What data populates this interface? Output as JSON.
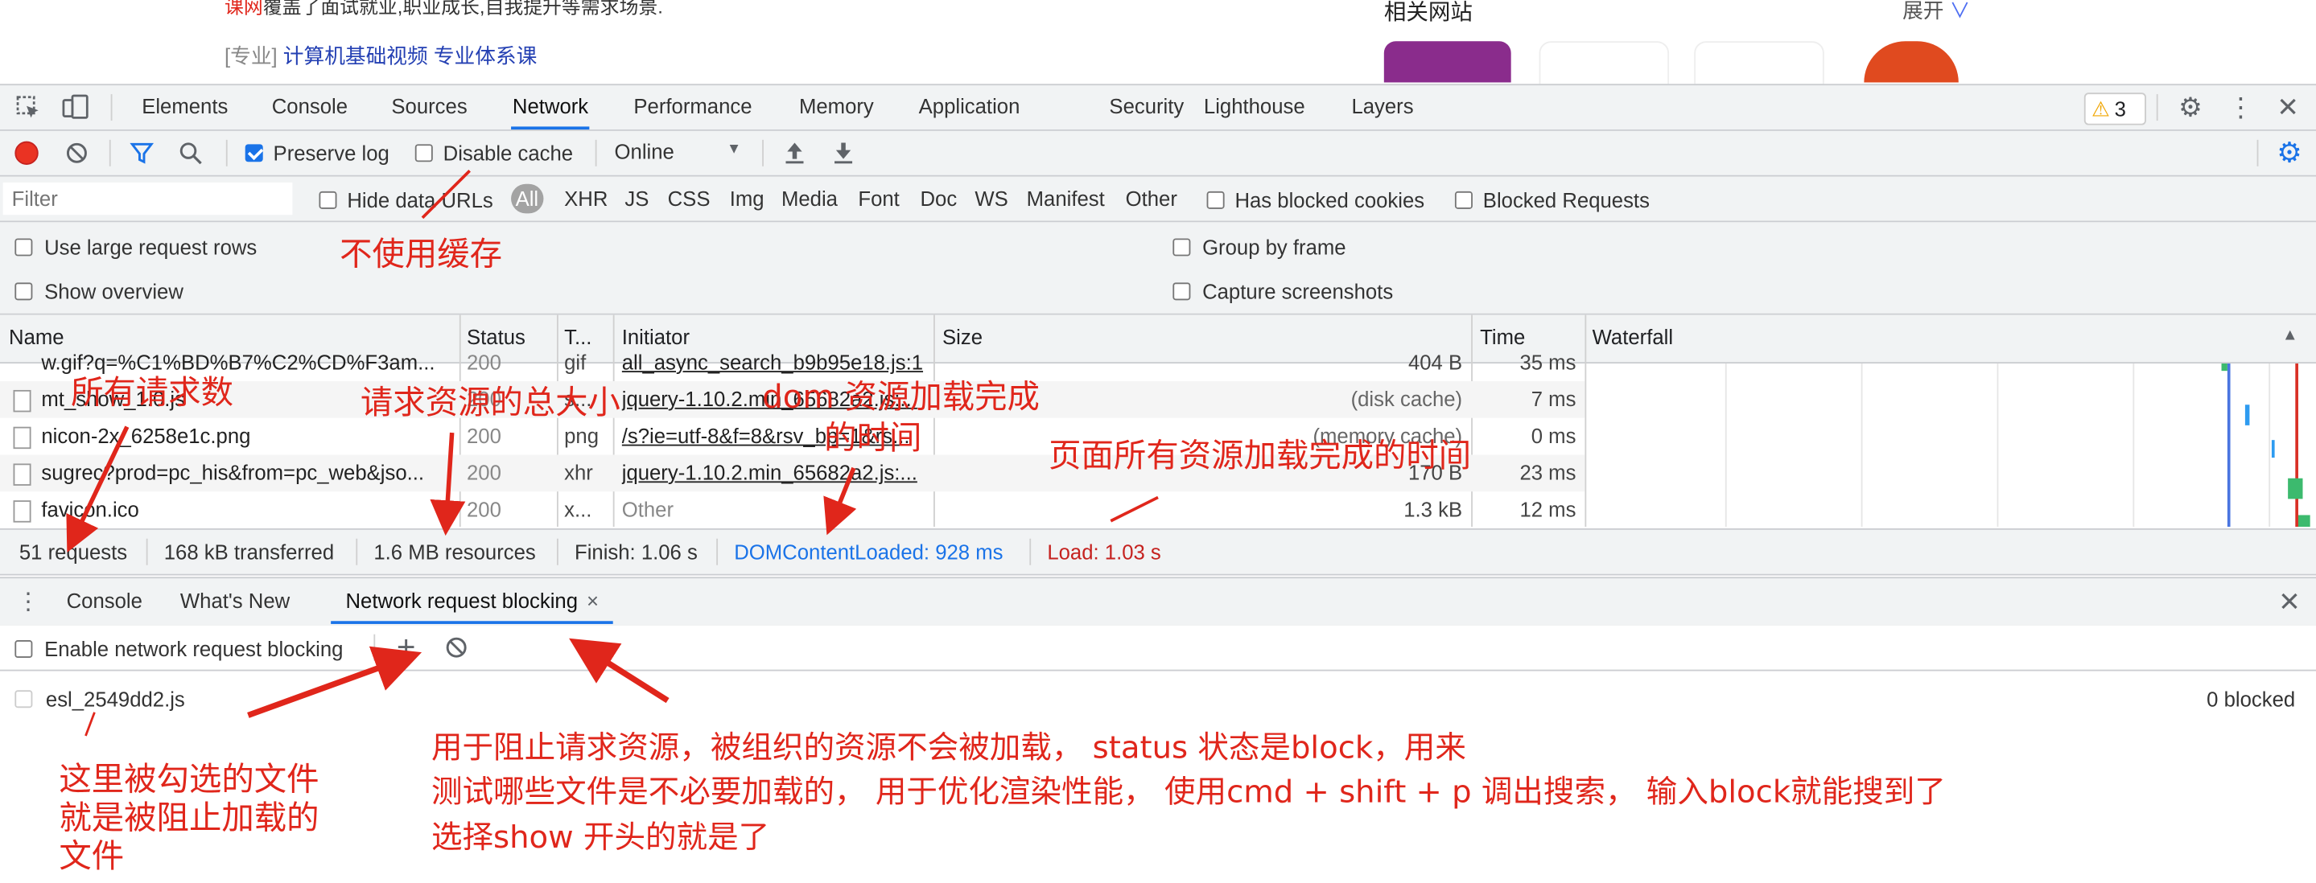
{
  "page_snippet": {
    "ad_prefix": "课网",
    "ad_text": "覆盖了面试就业,职业成长,自我提升等需求场景.",
    "course_tag": "[专业]",
    "course_link": "计算机基础视频 专业体系课",
    "related_title": "相关网站",
    "expand_label": "展开"
  },
  "devtools": {
    "tabs": [
      "Elements",
      "Console",
      "Sources",
      "Network",
      "Performance",
      "Memory",
      "Application",
      "Security",
      "Lighthouse",
      "Layers"
    ],
    "active_tab": "Network",
    "warning_count": "3",
    "toolbar": {
      "preserve_log": "Preserve log",
      "disable_cache": "Disable cache",
      "throttle": "Online"
    },
    "filter": {
      "placeholder": "Filter",
      "hide_data_urls": "Hide data URLs",
      "types": [
        "All",
        "XHR",
        "JS",
        "CSS",
        "Img",
        "Media",
        "Font",
        "Doc",
        "WS",
        "Manifest",
        "Other"
      ],
      "has_blocked_cookies": "Has blocked cookies",
      "blocked_requests": "Blocked Requests"
    },
    "options": {
      "large_rows": "Use large request rows",
      "show_overview": "Show overview",
      "group_by_frame": "Group by frame",
      "capture_screenshots": "Capture screenshots"
    },
    "table": {
      "columns": [
        "Name",
        "Status",
        "T...",
        "Initiator",
        "Size",
        "Time",
        "Waterfall"
      ],
      "rows": [
        {
          "name": "w.gif?q=%C1%BD%B7%C2%CD%F3am...",
          "status": "200",
          "type": "gif",
          "initiator": "all_async_search_b9b95e18.js:1",
          "size": "404 B",
          "time": "35 ms"
        },
        {
          "name": "mt_show_1.0.js",
          "status": "200",
          "type": "s...",
          "initiator": "jquery-1.10.2.min_65682a2.js:...",
          "size": "(disk cache)",
          "time": "7 ms"
        },
        {
          "name": "nicon-2x_6258e1c.png",
          "status": "200",
          "type": "png",
          "initiator": "/s?ie=utf-8&f=8&rsv_bp=1&rs...",
          "size": "(memory cache)",
          "time": "0 ms"
        },
        {
          "name": "sugrec?prod=pc_his&from=pc_web&jso...",
          "status": "200",
          "type": "xhr",
          "initiator": "jquery-1.10.2.min_65682a2.js:...",
          "size": "170 B",
          "time": "23 ms"
        },
        {
          "name": "favicon.ico",
          "status": "200",
          "type": "x...",
          "initiator": "Other",
          "size": "1.3 kB",
          "time": "12 ms"
        }
      ]
    },
    "summary": {
      "requests": "51 requests",
      "transferred": "168 kB transferred",
      "resources": "1.6 MB resources",
      "finish": "Finish: 1.06 s",
      "dcl": "DOMContentLoaded: 928 ms",
      "load": "Load: 1.03 s"
    },
    "drawer": {
      "tabs": [
        "Console",
        "What's New",
        "Network request blocking"
      ],
      "active_tab": "Network request blocking",
      "enable_label": "Enable network request blocking",
      "pattern": "esl_2549dd2.js",
      "blocked_count": "0 blocked"
    }
  },
  "annotations": {
    "disable_cache": "不使用缓存",
    "request_count": "所有请求数",
    "total_size": "请求资源的总大小",
    "dom_loaded_1": "dom 资源加载完成",
    "dom_loaded_2": "的时间",
    "load_time": "页面所有资源加载完成的时间",
    "checked_file_1": "这里被勾选的文件",
    "checked_file_2": "就是被阻止加载的",
    "checked_file_3": "文件",
    "blocking_1": "用于阻止请求资源，被组织的资源不会被加载， status 状态是block，用来",
    "blocking_2": "测试哪些文件是不必要加载的， 用于优化渲染性能， 使用cmd + shift + p 调出搜索， 输入block就能搜到了",
    "blocking_3": "选择show 开头的就是了"
  },
  "colors": {
    "accent": "#1a73e8",
    "annotation_red": "#e0261b",
    "dcl_blue": "#1a73e8",
    "load_red": "#c5221f",
    "toolbar_bg": "#f1f3f4"
  }
}
